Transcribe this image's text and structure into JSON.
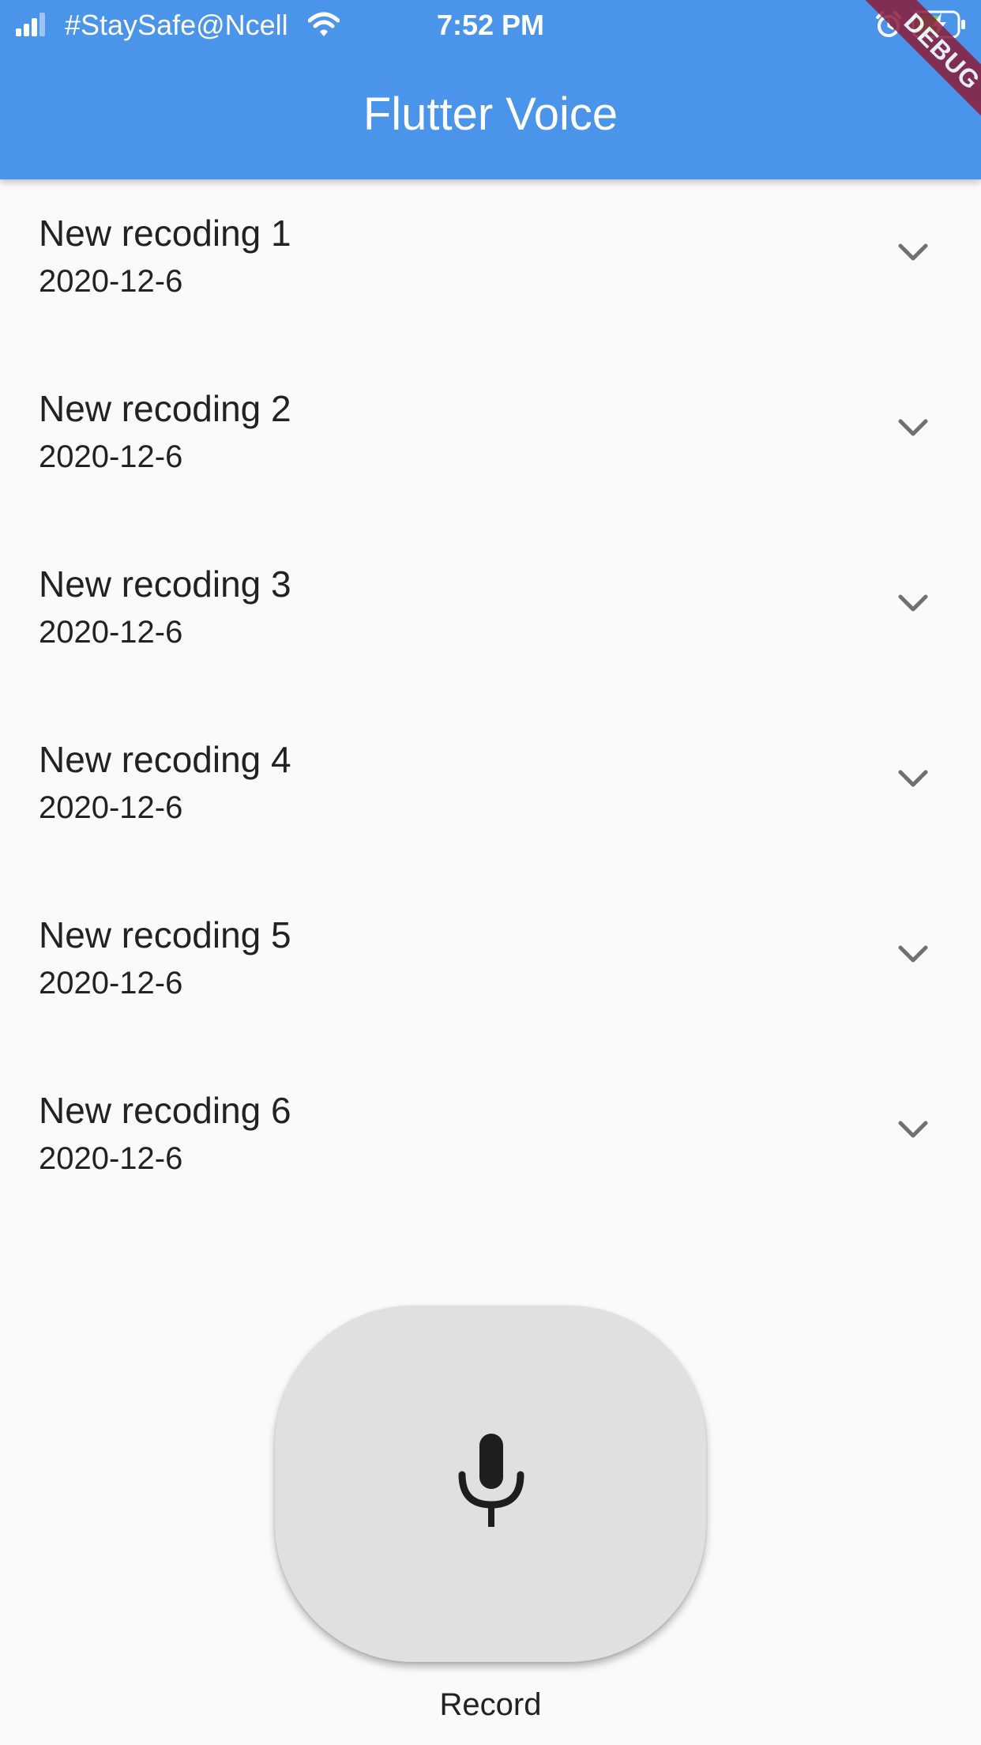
{
  "status_bar": {
    "carrier": "#StaySafe@Ncell",
    "time": "7:52 PM",
    "battery_icon": "battery-charging-icon",
    "signal_icon": "cellular-signal-icon",
    "wifi_icon": "wifi-icon",
    "alarm_icon": "alarm-icon"
  },
  "app_bar": {
    "title": "Flutter Voice",
    "color": "#4a94e9"
  },
  "debug_banner": {
    "label": "DEBUG",
    "color": "#8b1d3a"
  },
  "recordings": [
    {
      "title": "New recoding 1",
      "date": "2020-12-6"
    },
    {
      "title": "New recoding 2",
      "date": "2020-12-6"
    },
    {
      "title": "New recoding 3",
      "date": "2020-12-6"
    },
    {
      "title": "New recoding 4",
      "date": "2020-12-6"
    },
    {
      "title": "New recoding 5",
      "date": "2020-12-6"
    },
    {
      "title": "New recoding 6",
      "date": "2020-12-6"
    }
  ],
  "record_button": {
    "icon": "microphone-icon",
    "label": "Record",
    "background": "#e0e0e0"
  },
  "colors": {
    "page_background": "#fafafa",
    "text": "#222222",
    "chevron": "#707070"
  }
}
